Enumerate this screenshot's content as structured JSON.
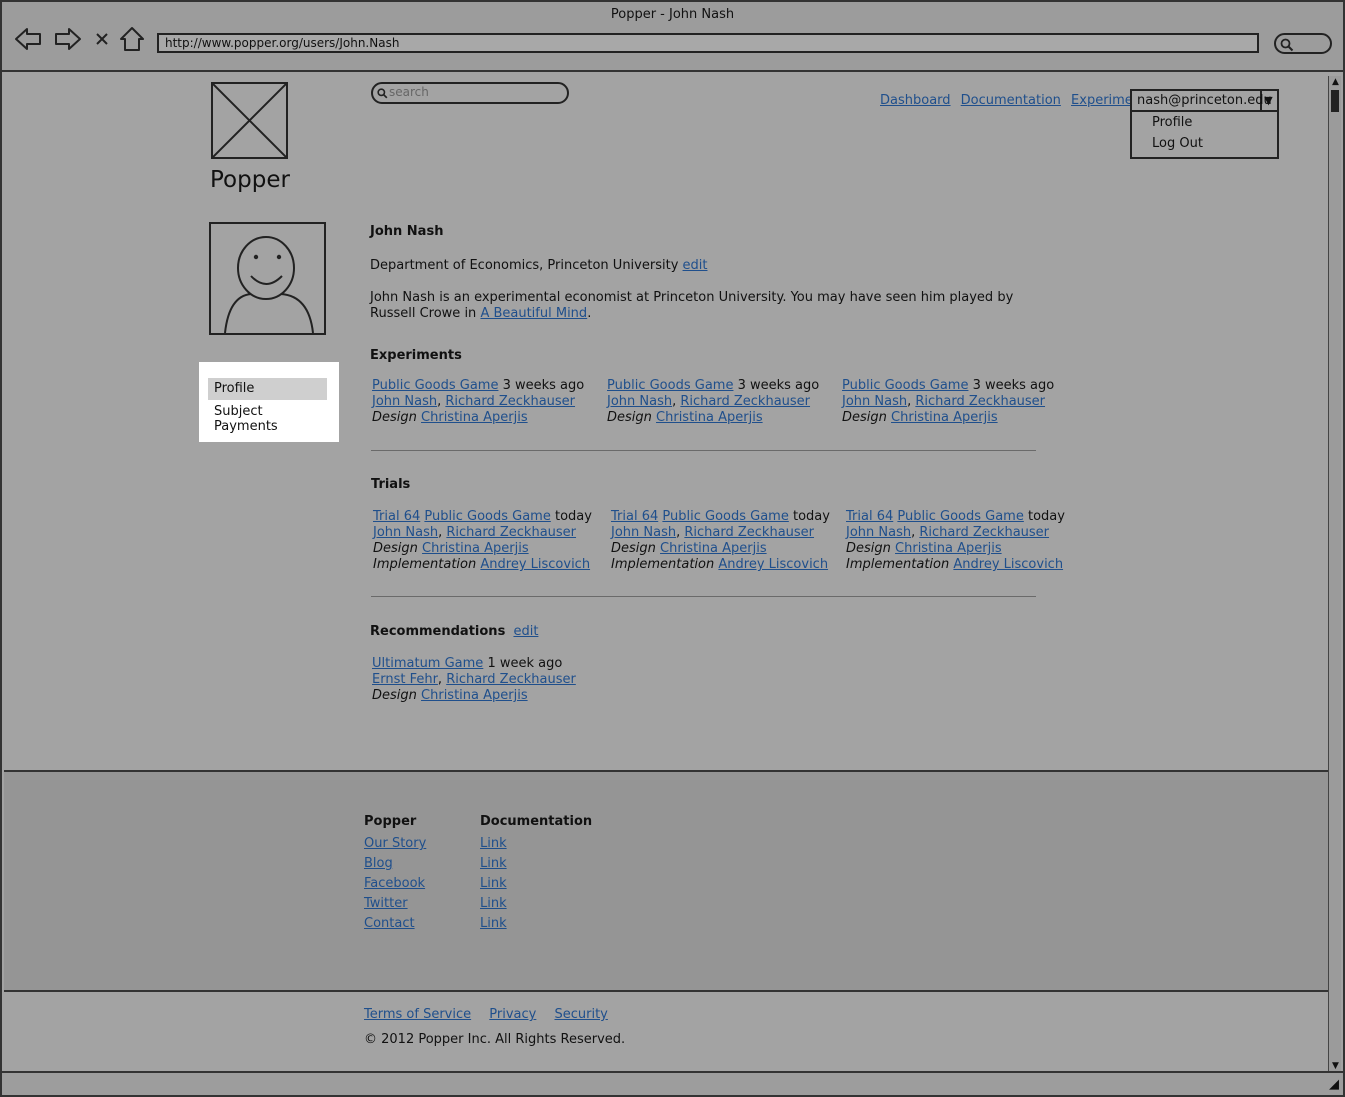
{
  "window": {
    "title": "Popper - John Nash",
    "url": "http://www.popper.org/users/John.Nash"
  },
  "header": {
    "brand": "Popper",
    "search_placeholder": "search",
    "nav": [
      "Dashboard",
      "Documentation",
      "Experiments"
    ],
    "account": {
      "email": "nash@princeton.edu",
      "options": [
        "Profile",
        "Log Out"
      ]
    }
  },
  "sidenav": {
    "items": [
      "Profile",
      "Subject Payments"
    ],
    "active": "Profile"
  },
  "profile": {
    "name": "John Nash",
    "department": "Department of Economics, Princeton University",
    "edit_label": "edit",
    "bio": "John Nash is an experimental economist at Princeton University. You may have seen him played by Russell Crowe in",
    "bio_link": "A Beautiful Mind",
    "bio_end": "."
  },
  "experiments": {
    "heading": "Experiments",
    "items": [
      {
        "game": "Public Goods Game",
        "when": "3 weeks ago",
        "people": [
          "John Nash",
          "Richard Zeckhauser"
        ],
        "design_label": "Design",
        "designer": "Christina Aperjis"
      },
      {
        "game": "Public Goods Game",
        "when": "3 weeks ago",
        "people": [
          "John Nash",
          "Richard Zeckhauser"
        ],
        "design_label": "Design",
        "designer": "Christina Aperjis"
      },
      {
        "game": "Public Goods Game",
        "when": "3 weeks ago",
        "people": [
          "John Nash",
          "Richard Zeckhauser"
        ],
        "design_label": "Design",
        "designer": "Christina Aperjis"
      }
    ]
  },
  "trials": {
    "heading": "Trials",
    "items": [
      {
        "trial": "Trial 64",
        "game": "Public Goods Game",
        "when": "today",
        "people": [
          "John Nash",
          "Richard Zeckhauser"
        ],
        "design_label": "Design",
        "designer": "Christina Aperjis",
        "impl_label": "Implementation",
        "implementer": "Andrey Liscovich"
      },
      {
        "trial": "Trial 64",
        "game": "Public Goods Game",
        "when": "today",
        "people": [
          "John Nash",
          "Richard Zeckhauser"
        ],
        "design_label": "Design",
        "designer": "Christina Aperjis",
        "impl_label": "Implementation",
        "implementer": "Andrey Liscovich"
      },
      {
        "trial": "Trial 64",
        "game": "Public Goods Game",
        "when": "today",
        "people": [
          "John Nash",
          "Richard Zeckhauser"
        ],
        "design_label": "Design",
        "designer": "Christina Aperjis",
        "impl_label": "Implementation",
        "implementer": "Andrey Liscovich"
      }
    ]
  },
  "recommendations": {
    "heading": "Recommendations",
    "edit_label": "edit",
    "items": [
      {
        "game": "Ultimatum Game",
        "when": "1 week ago",
        "people": [
          "Ernst Fehr",
          "Richard Zeckhauser"
        ],
        "design_label": "Design",
        "designer": "Christina Aperjis"
      }
    ]
  },
  "footer": {
    "col1": {
      "heading": "Popper",
      "links": [
        "Our Story",
        "Blog",
        "Facebook",
        "Twitter",
        "Contact"
      ]
    },
    "col2": {
      "heading": "Documentation",
      "links": [
        "Link",
        "Link",
        "Link",
        "Link",
        "Link"
      ]
    },
    "legal": [
      "Terms of Service",
      "Privacy",
      "Security"
    ],
    "copyright": "© 2012 Popper Inc. All Rights Reserved."
  }
}
